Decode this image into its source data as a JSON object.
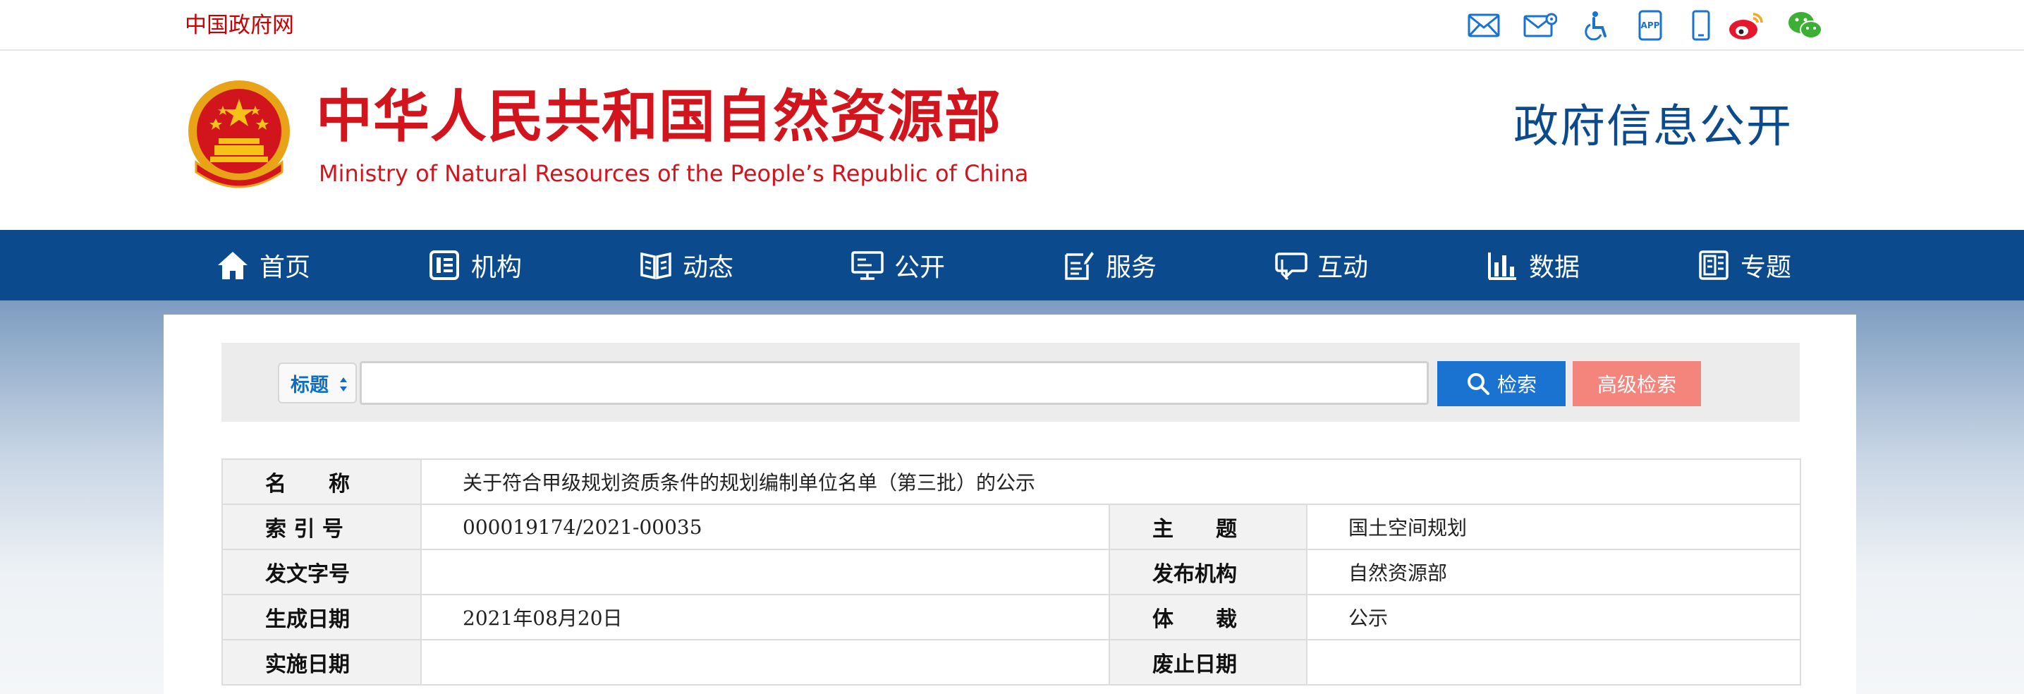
{
  "topbar": {
    "gov_link": "中国政府网",
    "icons": [
      "mail-icon",
      "mail-settings-icon",
      "accessibility-icon",
      "app-icon",
      "mobile-icon",
      "weibo-icon",
      "wechat-icon"
    ],
    "app_label": "APP"
  },
  "header": {
    "title": "中华人民共和国自然资源部",
    "subtitle": "Ministry of Natural Resources of the People’s Republic of China",
    "section_title": "政府信息公开"
  },
  "nav": {
    "items": [
      {
        "label": "首页",
        "icon": "home-icon"
      },
      {
        "label": "机构",
        "icon": "organization-icon"
      },
      {
        "label": "动态",
        "icon": "news-icon"
      },
      {
        "label": "公开",
        "icon": "disclosure-icon"
      },
      {
        "label": "服务",
        "icon": "service-icon"
      },
      {
        "label": "互动",
        "icon": "interaction-icon"
      },
      {
        "label": "数据",
        "icon": "data-chart-icon"
      },
      {
        "label": "专题",
        "icon": "topic-icon"
      }
    ]
  },
  "search": {
    "field_label": "标题",
    "query": "",
    "search_button": "检索",
    "advanced_button": "高级检索"
  },
  "info": {
    "name_label": "名　　称",
    "name_value": "关于符合甲级规划资质条件的规划编制单位名单（第三批）的公示",
    "index_label": "索 引 号",
    "index_value": "000019174/2021-00035",
    "topic_label": "主　　题",
    "topic_value": "国土空间规划",
    "doc_no_label": "发文字号",
    "doc_no_value": "",
    "publisher_label": "发布机构",
    "publisher_value": "自然资源部",
    "created_label": "生成日期",
    "created_value": "2021年08月20日",
    "genre_label": "体　　裁",
    "genre_value": "公示",
    "effective_label": "实施日期",
    "effective_value": "",
    "expiry_label": "废止日期",
    "expiry_value": ""
  },
  "colors": {
    "brand_red": "#d2141c",
    "nav_blue": "#0c4a8e",
    "search_blue": "#1a73d1",
    "advanced_pink": "#f4857d"
  }
}
